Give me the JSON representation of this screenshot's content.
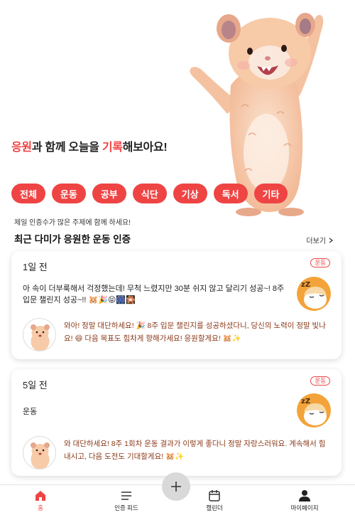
{
  "hero": {
    "headline_parts": [
      "응원",
      "과 함께 오늘을 ",
      "기록",
      "해보아요!"
    ]
  },
  "categories": [
    "전체",
    "운동",
    "공부",
    "식단",
    "기상",
    "독서",
    "기타"
  ],
  "feed": {
    "hint": "제일 인증수가 많은 주제에 함께 하세요!",
    "section_title": "최근 다미가 응원한 운동 인증",
    "more_label": "더보기"
  },
  "posts": [
    {
      "time": "1일 전",
      "category": "운동",
      "body": "아 속이 더부룩해서 걱정했는데! 무척 느렸지만 30분 쉬지 않고 달리기 성공~! 8주 입문 챌린지 성공~!! 🐹🎉😝🎆🎇",
      "reply": "와아! 정말 대단하세요! 🎉 8주 입문 챌린지를 성공하셨다니, 당신의 노력이 정말 빛나요! 😄 다음 목표도 힘차게 향해가세요! 응원할게요! 🐹✨"
    },
    {
      "time": "5일 전",
      "category": "운동",
      "body": "운동",
      "reply": "와 대단하세요! 8주 1회차 운동 결과가 이렇게 좋다니 정말 자랑스러워요. 계속해서 힘내시고, 다음 도전도 기대할게요! 🐹✨"
    }
  ],
  "nav": {
    "tabs": [
      "홈",
      "인증 피드",
      "캘린더",
      "마이페이지"
    ],
    "active": "홈"
  },
  "colors": {
    "accent": "#ef4444",
    "reply_text": "#8b3a1a"
  }
}
